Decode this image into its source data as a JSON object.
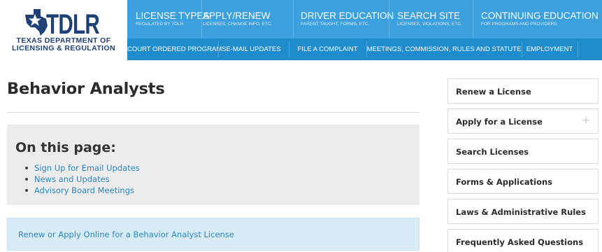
{
  "logo": {
    "name": "TDLR",
    "subtitle_line1": "TEXAS DEPARTMENT OF",
    "subtitle_line2": "LICENSING & REGULATION",
    "color": "#1f3f77"
  },
  "nav": {
    "top": [
      {
        "title": "LICENSE TYPES",
        "subtitle": "REGULATED BY TDLR"
      },
      {
        "title": "APPLY/RENEW",
        "subtitle": "LICENSES, CHANGE INFO, ETC."
      },
      {
        "title": "DRIVER EDUCATION",
        "subtitle": "PARENT TAUGHT, FORMS, ETC."
      },
      {
        "title": "SEARCH SITE",
        "subtitle": "LICENSES, VIOLATIONS, ETC."
      },
      {
        "title": "CONTINUING EDUCATION",
        "subtitle": "FOR PROGRAMS AND PROVIDERS"
      }
    ],
    "bottom": [
      "COURT ORDERED PROGRAMS",
      "E-MAIL UPDATES",
      "FILE A COMPLAINT",
      "MEETINGS, COMMISSION, RULES AND STATUTE",
      "EMPLOYMENT"
    ],
    "top_color": "#3ba0dd",
    "bottom_color": "#1e8ccd"
  },
  "main": {
    "title": "Behavior Analysts",
    "on_this_page": {
      "heading": "On this page:",
      "links": [
        "Sign Up for Email Updates",
        "News and Updates",
        "Advisory Board Meetings"
      ]
    },
    "renew_link": "Renew or Apply Online for a Behavior Analyst License",
    "link_color": "#2b86c5"
  },
  "sidebar": {
    "items": [
      {
        "label": "Renew a License",
        "expand": ""
      },
      {
        "label": "Apply for a License",
        "expand": "+"
      },
      {
        "label": "Search Licenses",
        "expand": ""
      },
      {
        "label": "Forms & Applications",
        "expand": ""
      },
      {
        "label": "Laws & Administrative Rules",
        "expand": ""
      },
      {
        "label": "Frequently Asked Questions",
        "expand": ""
      }
    ]
  }
}
